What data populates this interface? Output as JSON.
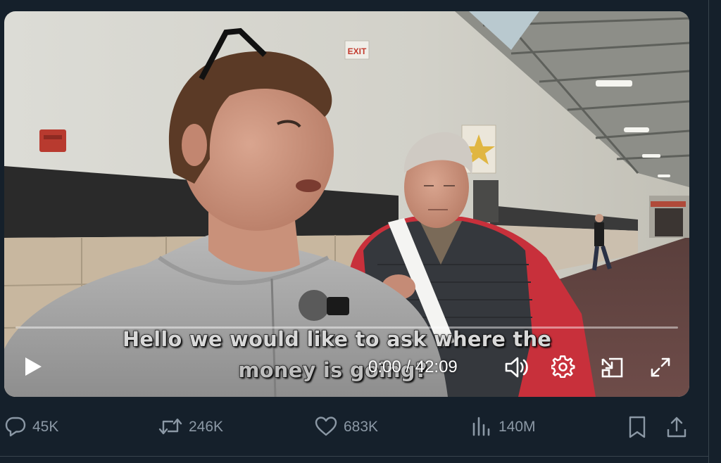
{
  "video": {
    "caption_line1": "Hello we would like to ask where the",
    "caption_line2": "money is going?",
    "current_time": "0:00",
    "duration": "42:09",
    "time_display": "0:00 / 42:09",
    "progress_percent": 0,
    "sign_text": "EXIT"
  },
  "icons": {
    "play": "play-icon",
    "volume": "volume-icon",
    "settings": "gear-icon",
    "pip": "picture-in-picture-icon",
    "fullscreen": "fullscreen-icon",
    "reply": "reply-icon",
    "repost": "repost-icon",
    "like": "heart-icon",
    "views": "views-bar-chart-icon",
    "bookmark": "bookmark-icon",
    "share": "share-icon"
  },
  "actions": {
    "replies": "45K",
    "reposts": "246K",
    "likes": "683K",
    "views": "140M"
  },
  "colors": {
    "background": "#15202b",
    "icon_gray": "#8b98a5",
    "divider": "#38444d"
  }
}
